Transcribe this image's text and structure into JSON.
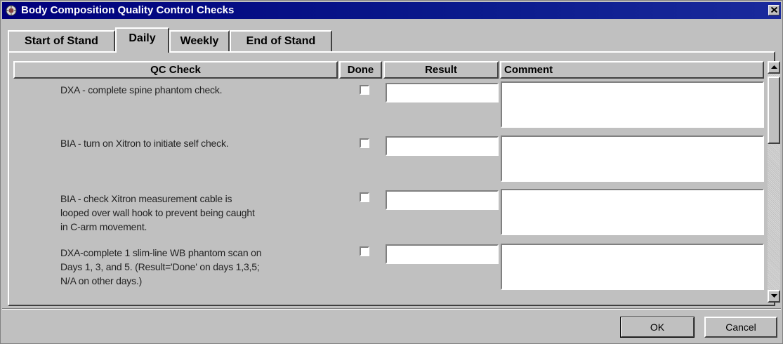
{
  "window": {
    "title": "Body Composition Quality Control Checks",
    "title_bar_color": "#00007c",
    "icons": {
      "app": "app-icon",
      "close": "close-icon"
    }
  },
  "tabs": [
    {
      "label": "Start of Stand",
      "active": false
    },
    {
      "label": "Daily",
      "active": true
    },
    {
      "label": "Weekly",
      "active": false
    },
    {
      "label": "End of Stand",
      "active": false
    }
  ],
  "table": {
    "headers": {
      "check": "QC Check",
      "done": "Done",
      "result": "Result",
      "comment": "Comment"
    },
    "rows": [
      {
        "lines": [
          "DXA - complete spine phantom check."
        ],
        "done": false,
        "result": "",
        "comment": ""
      },
      {
        "lines": [
          "BIA - turn on Xitron to initiate self check."
        ],
        "done": false,
        "result": "",
        "comment": ""
      },
      {
        "lines": [
          "BIA - check Xitron measurement cable is",
          "looped over wall hook to prevent being caught",
          "in C-arm movement."
        ],
        "done": false,
        "result": "",
        "comment": ""
      },
      {
        "lines": [
          "DXA-complete 1 slim-line WB phantom scan on",
          "Days 1, 3, and 5. (Result='Done' on days 1,3,5;",
          "N/A on other days.)"
        ],
        "done": false,
        "result": "",
        "comment": ""
      }
    ]
  },
  "scrollbar": {
    "up_icon": "scroll-up-arrow-icon",
    "down_icon": "scroll-down-arrow-icon"
  },
  "buttons": {
    "ok": "OK",
    "cancel": "Cancel"
  }
}
